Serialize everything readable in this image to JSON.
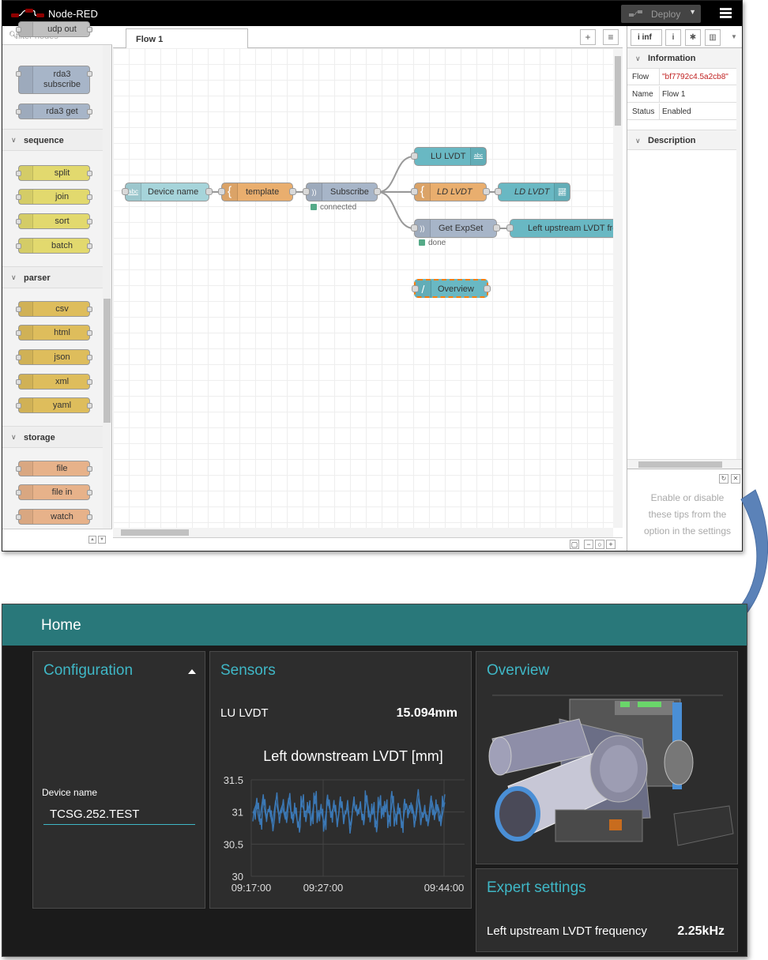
{
  "nodered": {
    "app_title": "Node-RED",
    "deploy_label": "Deploy",
    "palette": {
      "filter_placeholder": "filter nodes",
      "top_partial": "udp out",
      "rda3": [
        "rda3 subscribe",
        "rda3 get"
      ],
      "categories": [
        {
          "label": "sequence",
          "nodes": [
            "split",
            "join",
            "sort",
            "batch"
          ],
          "color": "#e2d96e"
        },
        {
          "label": "parser",
          "nodes": [
            "csv",
            "html",
            "json",
            "xml",
            "yaml"
          ],
          "color": "#debd5c"
        },
        {
          "label": "storage",
          "nodes": [
            "file",
            "file in",
            "watch"
          ],
          "color": "#e7b28a"
        }
      ]
    },
    "workspace": {
      "tab": "Flow 1",
      "nodes": {
        "device_name": "Device name",
        "template": "template",
        "subscribe": "Subscribe",
        "subscribe_status": "connected",
        "lu_lvdt": "LU LVDT",
        "ld_lvdt_fn": "LD LVDT",
        "ld_lvdt_chart": "LD LVDT",
        "get_expset": "Get ExpSet",
        "get_expset_status": "done",
        "left_upstream": "Left upstream LVDT fre",
        "overview": "Overview"
      }
    },
    "sidebar": {
      "tab_label": "inf",
      "section_information": "Information",
      "props": [
        {
          "key": "Flow",
          "value": "\"bf7792c4.5a2cb8\""
        },
        {
          "key": "Name",
          "value": "Flow 1"
        },
        {
          "key": "Status",
          "value": "Enabled"
        }
      ],
      "section_description": "Description",
      "tips": "Enable or disable these tips from the option in the settings"
    }
  },
  "dashboard": {
    "title": "Home",
    "configuration": {
      "title": "Configuration",
      "device_label": "Device name",
      "device_value": "TCSG.252.TEST"
    },
    "sensors": {
      "title": "Sensors",
      "lu_label": "LU LVDT",
      "lu_value": "15.094mm"
    },
    "overview": {
      "title": "Overview"
    },
    "expert": {
      "title": "Expert settings",
      "label": "Left upstream LVDT frequency",
      "value": "2.25kHz"
    }
  },
  "chart_data": {
    "type": "line",
    "title": "Left downstream LVDT [mm]",
    "xlabel": "",
    "ylabel": "",
    "x_ticks": [
      "09:17:00",
      "09:27:00",
      "09:44:00"
    ],
    "y_ticks": [
      "31.5",
      "31",
      "30.5",
      "30"
    ],
    "ylim": [
      30,
      31.5
    ],
    "series_color": "#3b78b5",
    "series": [
      {
        "values": [
          30.98,
          31.12,
          30.85,
          31.2,
          30.92,
          31.05,
          30.8,
          31.18,
          30.95,
          31.1,
          30.88,
          31.22,
          30.9,
          31.02,
          30.78,
          31.15,
          30.97,
          31.08,
          30.86,
          31.25,
          30.93,
          31.0,
          30.82,
          31.17,
          30.96,
          31.11,
          30.84,
          31.19,
          30.91,
          31.06,
          30.79,
          31.14,
          30.99,
          31.09,
          30.87,
          31.21,
          30.94,
          31.03,
          30.81,
          31.16,
          30.97,
          31.12,
          30.85,
          31.2,
          30.9,
          31.04,
          30.8,
          31.13,
          30.98,
          31.1,
          30.86,
          31.23,
          30.92,
          31.01,
          30.83,
          31.18,
          30.95,
          31.07,
          30.88,
          31.15
        ]
      }
    ]
  }
}
